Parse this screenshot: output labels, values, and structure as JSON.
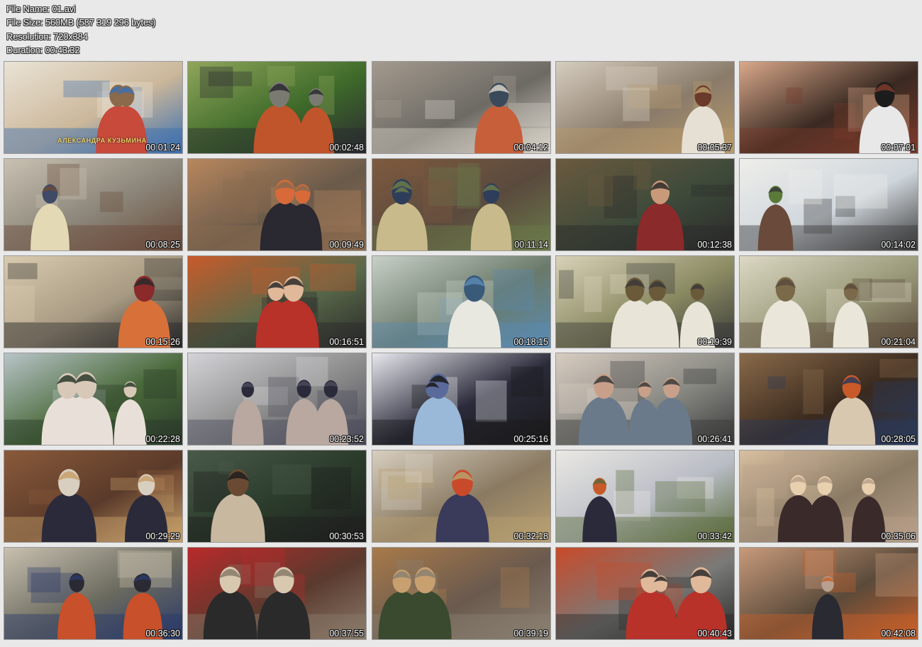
{
  "file_info": {
    "name_line": "File Name: 01.avi",
    "size_line": "File Size: 560MB (587 319 296 bytes)",
    "resolution_line": "Resolution: 720x384",
    "duration_line": "Duration: 00:43:32"
  },
  "thumbnails": [
    {
      "time": "00:01:24",
      "caption": "АЛЕКСАНДРА КУЗЬМИНА",
      "palette": [
        "#cbb79a",
        "#eae3d6",
        "#8a6a4a",
        "#c74a3a",
        "#3b6fb0"
      ]
    },
    {
      "time": "00:02:48",
      "palette": [
        "#3e6a2a",
        "#8fa65a",
        "#7a7a72",
        "#c0542b",
        "#2a2a30"
      ]
    },
    {
      "time": "00:04:12",
      "palette": [
        "#6d6a64",
        "#a39a8e",
        "#3a4a5a",
        "#c65f3a",
        "#d8d2c8"
      ]
    },
    {
      "time": "00:05:37",
      "palette": [
        "#8a7b6a",
        "#d6cdbf",
        "#6a3a2a",
        "#e6e0d4",
        "#b89a6a"
      ]
    },
    {
      "time": "00:07:01",
      "palette": [
        "#3a2a22",
        "#d9a88a",
        "#1c1c1c",
        "#e8e8e8",
        "#7a3a2a"
      ]
    },
    {
      "time": "00:08:25",
      "palette": [
        "#8a8578",
        "#c9c1b2",
        "#3e4a66",
        "#e4d9b5",
        "#6a4a3a"
      ]
    },
    {
      "time": "00:09:49",
      "palette": [
        "#6a5a4a",
        "#b8875e",
        "#d86a3a",
        "#2a2830",
        "#8a6a4e"
      ]
    },
    {
      "time": "00:11:14",
      "palette": [
        "#5a4a3e",
        "#7e5a3e",
        "#2e3e5a",
        "#c8ba8a",
        "#6a7a4a"
      ]
    },
    {
      "time": "00:12:38",
      "palette": [
        "#3e4a3a",
        "#6a5a3e",
        "#c89a7a",
        "#8a2a2a",
        "#2a2a2a"
      ]
    },
    {
      "time": "00:14:02",
      "palette": [
        "#cfd6dc",
        "#eeeeea",
        "#5a7a3a",
        "#6a4a3a",
        "#3a3a3a"
      ]
    },
    {
      "time": "00:15:26",
      "palette": [
        "#a89a82",
        "#d9cbb0",
        "#8a2a2a",
        "#d8703a",
        "#2a2a2a"
      ]
    },
    {
      "time": "00:16:51",
      "palette": [
        "#5a6a4a",
        "#c85a2a",
        "#e0b89a",
        "#b8322a",
        "#2a2a2a"
      ]
    },
    {
      "time": "00:18:15",
      "palette": [
        "#6a7a6a",
        "#c8d0c8",
        "#3a5a7a",
        "#e8e8e0",
        "#5a8ab0"
      ]
    },
    {
      "time": "00:19:39",
      "palette": [
        "#8a8a62",
        "#d8d2b8",
        "#6a5a3a",
        "#e8e4d8",
        "#3a3a3a"
      ]
    },
    {
      "time": "00:21:04",
      "palette": [
        "#9a9a7a",
        "#dcd8c4",
        "#7a6a4a",
        "#eae6da",
        "#5a4a3a"
      ]
    },
    {
      "time": "00:22:28",
      "palette": [
        "#4a6a3a",
        "#b8c4c8",
        "#d8c8b8",
        "#e8e0d8",
        "#2a3a2a"
      ]
    },
    {
      "time": "00:23:52",
      "palette": [
        "#8a8a8a",
        "#d4d4d8",
        "#2a2a3a",
        "#b8a8a0",
        "#4a4a5a"
      ]
    },
    {
      "time": "00:25:16",
      "palette": [
        "#2a2a3a",
        "#e8e8ee",
        "#5a6a9a",
        "#9ab8d8",
        "#1a1a1a"
      ]
    },
    {
      "time": "00:26:41",
      "palette": [
        "#8a8a84",
        "#d8ccc0",
        "#c8a08a",
        "#6a7a8a",
        "#3a3a3a"
      ]
    },
    {
      "time": "00:28:05",
      "palette": [
        "#3a2a1e",
        "#8a6a4a",
        "#c85a2a",
        "#d8c8b0",
        "#2a3a5a"
      ]
    },
    {
      "time": "00:29:29",
      "palette": [
        "#5a3a2a",
        "#8a5a3a",
        "#d8cfc0",
        "#2a2a3a",
        "#c8a06a"
      ]
    },
    {
      "time": "00:30:53",
      "palette": [
        "#2a3a2a",
        "#4a5a4a",
        "#6a4a32",
        "#c8b8a0",
        "#1e1e1e"
      ]
    },
    {
      "time": "00:32:18",
      "palette": [
        "#8a7a62",
        "#d8cfc0",
        "#c84a2a",
        "#3a3a5a",
        "#b8a070"
      ]
    },
    {
      "time": "00:33:42",
      "palette": [
        "#b8bcc4",
        "#eae8e4",
        "#c85a2a",
        "#2a2a3a",
        "#5a6a3a"
      ]
    },
    {
      "time": "00:35:06",
      "palette": [
        "#8a7a64",
        "#d8bfa0",
        "#e8cfae",
        "#3a2a2a",
        "#b8a08a"
      ]
    },
    {
      "time": "00:36:30",
      "palette": [
        "#6a6a5e",
        "#c8c0b0",
        "#2a2a32",
        "#c8502a",
        "#2a3a6a"
      ]
    },
    {
      "time": "00:37:55",
      "palette": [
        "#5a3a2e",
        "#b82a2a",
        "#d8c8b0",
        "#2a2a2a",
        "#8a7a6a"
      ]
    },
    {
      "time": "00:39:19",
      "palette": [
        "#6a5a4e",
        "#a87a4a",
        "#c8a070",
        "#3a4a2e",
        "#8a8070"
      ]
    },
    {
      "time": "00:40:43",
      "palette": [
        "#7a7a78",
        "#c84a2a",
        "#e0b89a",
        "#b8322a",
        "#2a2a2a"
      ]
    },
    {
      "time": "00:42:08",
      "palette": [
        "#5a4a3a",
        "#c89a7a",
        "#b8a090",
        "#2a2a32",
        "#c8602a"
      ]
    }
  ]
}
